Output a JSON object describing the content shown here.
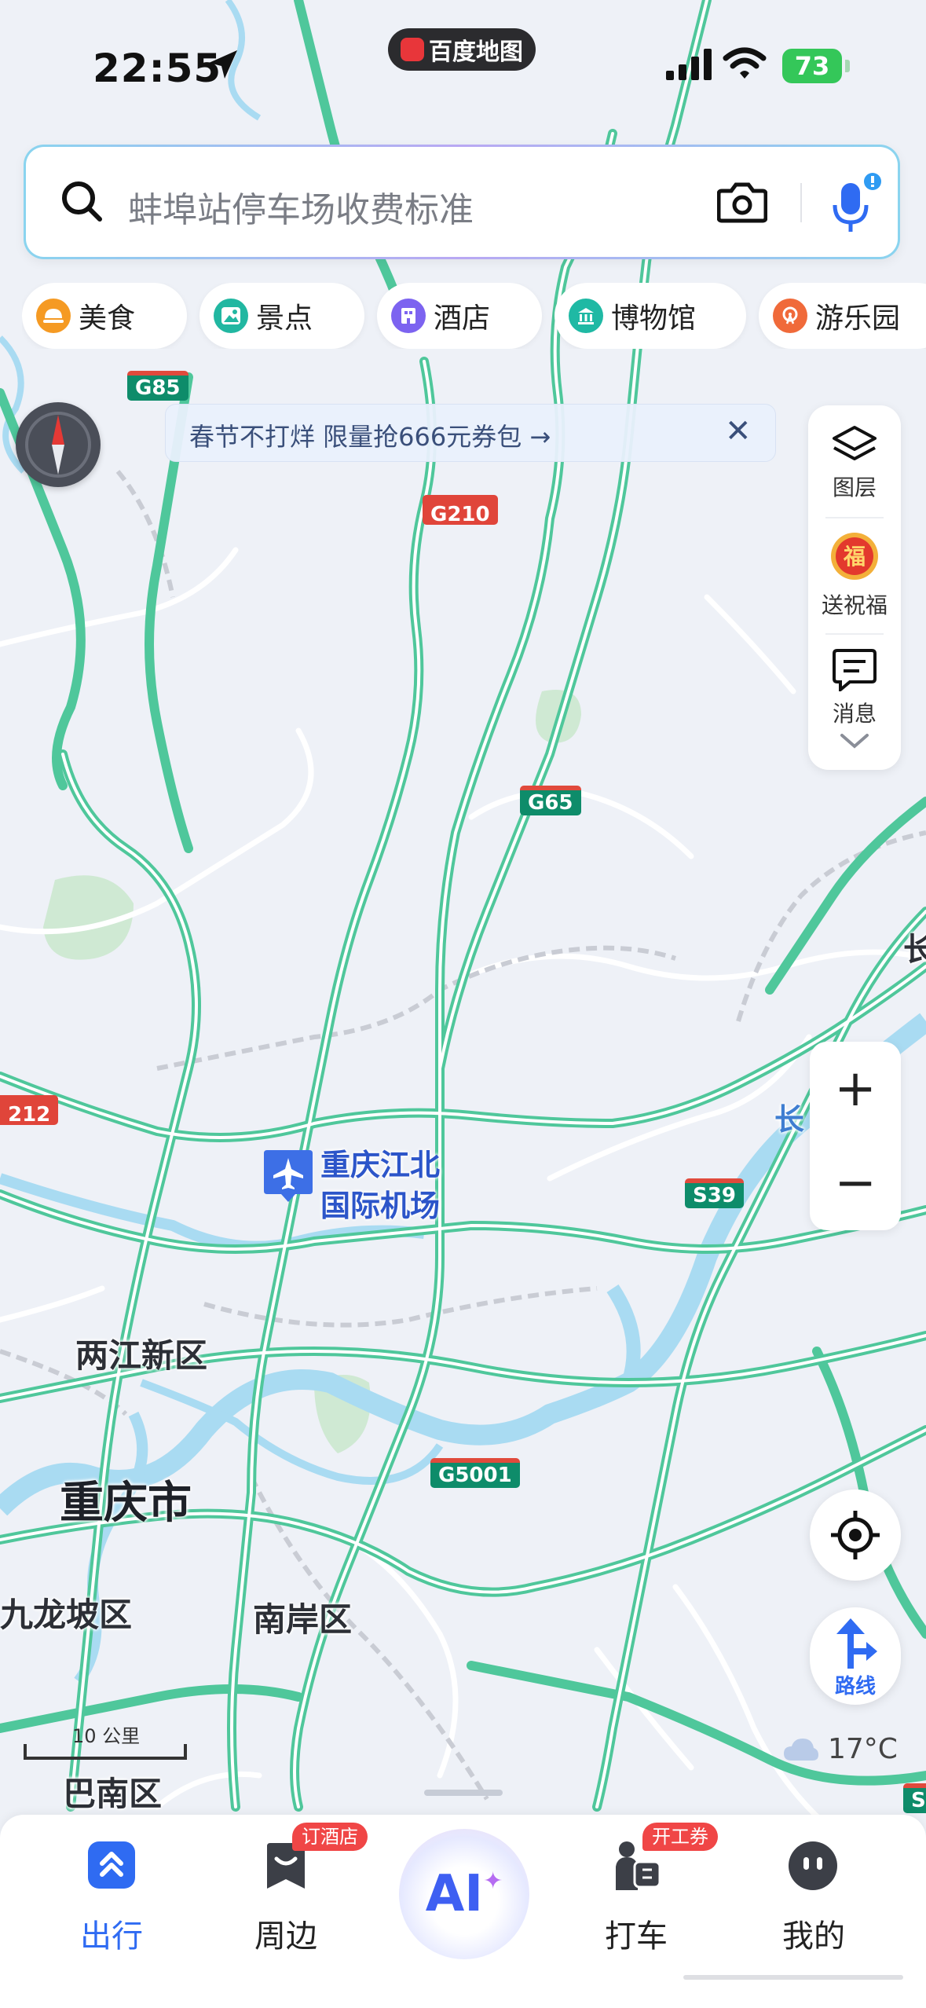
{
  "status_bar": {
    "time": "22:55",
    "app_name": "百度地图",
    "battery": "73"
  },
  "search": {
    "placeholder": "蚌埠站停车场收费标准",
    "icons": [
      "search-icon",
      "camera-icon",
      "mic-icon"
    ]
  },
  "categories": [
    {
      "label": "美食",
      "color": "#f59a23"
    },
    {
      "label": "景点",
      "color": "#21b7a1"
    },
    {
      "label": "酒店",
      "color": "#7c63f0"
    },
    {
      "label": "博物馆",
      "color": "#1fb9a4"
    },
    {
      "label": "游乐园",
      "color": "#f06a3a"
    }
  ],
  "banner": {
    "text": "春节不打烊 限量抢666元券包 →"
  },
  "right_panel": {
    "layers_label": "图层",
    "greeting_label": "送祝福",
    "messages_label": "消息"
  },
  "zoom": {
    "in": "+",
    "out": "−"
  },
  "route_button": {
    "label": "路线"
  },
  "weather": {
    "temperature": "17°C"
  },
  "scale": {
    "label": "10 公里"
  },
  "map": {
    "labels": {
      "airport": "重庆江北国际机场",
      "airport_line1": "重庆江北",
      "airport_line2": "国际机场",
      "liangjiang": "两江新区",
      "chongqing": "重庆市",
      "jiulongpo": "九龙坡区",
      "nanan": "南岸区",
      "banan": "巴南区",
      "chang_river": "长",
      "chang_edge": "长"
    },
    "shields": {
      "g85": "G85",
      "g210": "G210",
      "g65": "G65",
      "s39": "S39",
      "g5001": "G5001",
      "g212": "212",
      "s_edge": "S"
    },
    "colors": {
      "road": "#4fc79b",
      "river": "#a9dbf2",
      "land": "#eef1f7",
      "green": "#cfe9d3",
      "accent": "#2f6bf2"
    }
  },
  "tabbar": {
    "tabs": [
      {
        "label": "出行",
        "active": true
      },
      {
        "label": "周边",
        "badge": "订酒店"
      },
      {
        "label": "AI"
      },
      {
        "label": "打车",
        "badge": "开工券"
      },
      {
        "label": "我的"
      }
    ]
  }
}
